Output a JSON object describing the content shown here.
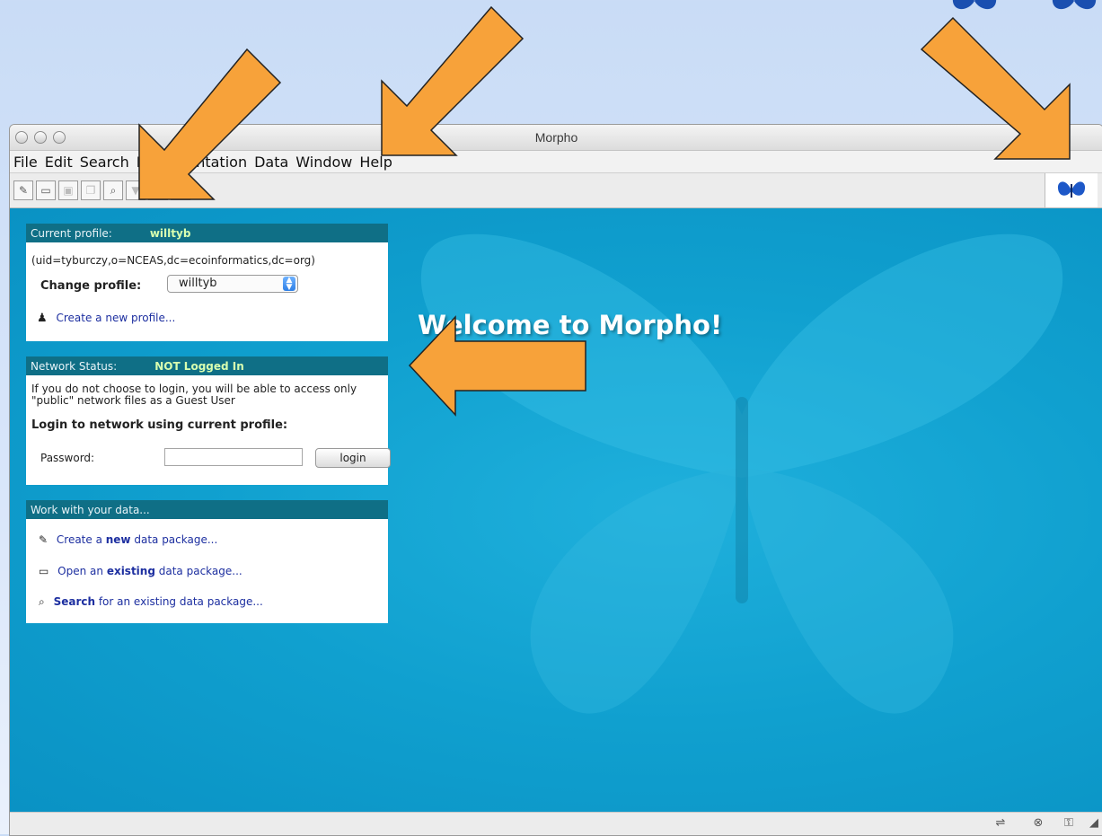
{
  "window": {
    "title": "Morpho"
  },
  "menu": [
    "File",
    "Edit",
    "Search",
    "Documentation",
    "Data",
    "Window",
    "Help"
  ],
  "toolbar": {
    "buttons": [
      {
        "icon": "new-package-icon",
        "glyph": "✎",
        "enabled": true
      },
      {
        "icon": "open-package-icon",
        "glyph": "▭",
        "enabled": true
      },
      {
        "icon": "save-icon",
        "glyph": "▣",
        "enabled": false
      },
      {
        "icon": "copy-icon",
        "glyph": "❐",
        "enabled": false
      },
      {
        "icon": "search-icon",
        "glyph": "⌕",
        "enabled": true
      },
      {
        "icon": "filter-icon",
        "glyph": "▼",
        "enabled": false
      },
      {
        "icon": "document-icon",
        "glyph": "▤",
        "enabled": false
      },
      {
        "icon": "lock-icon",
        "glyph": "⚿",
        "enabled": false
      }
    ]
  },
  "welcome": "Welcome to Morpho!",
  "profile": {
    "header_label": "Current profile:",
    "header_value": "willtyb",
    "dn": "(uid=tyburczy,o=NCEAS,dc=ecoinformatics,dc=org)",
    "change_label": "Change profile:",
    "selected": "willtyb",
    "create_link": "Create a new profile..."
  },
  "network": {
    "header_label": "Network Status:",
    "header_value": "NOT Logged In",
    "note": "If you do not choose to login, you will be able to access only \"public\" network files as a Guest User",
    "login_heading": "Login to network using current profile:",
    "password_label": "Password:",
    "login_button": "login"
  },
  "data_panel": {
    "header_label": "Work with your data...",
    "create": {
      "pre": "Create a ",
      "bold": "new",
      "post": " data package..."
    },
    "open": {
      "pre": "Open an ",
      "bold": "existing",
      "post": " data package..."
    },
    "search": {
      "pre": "",
      "bold": "Search",
      "post": " for an existing data package..."
    }
  },
  "colors": {
    "accent_teal": "#0f6f86",
    "content_blue": "#10a0cf",
    "arrow_orange": "#f7a23a"
  }
}
